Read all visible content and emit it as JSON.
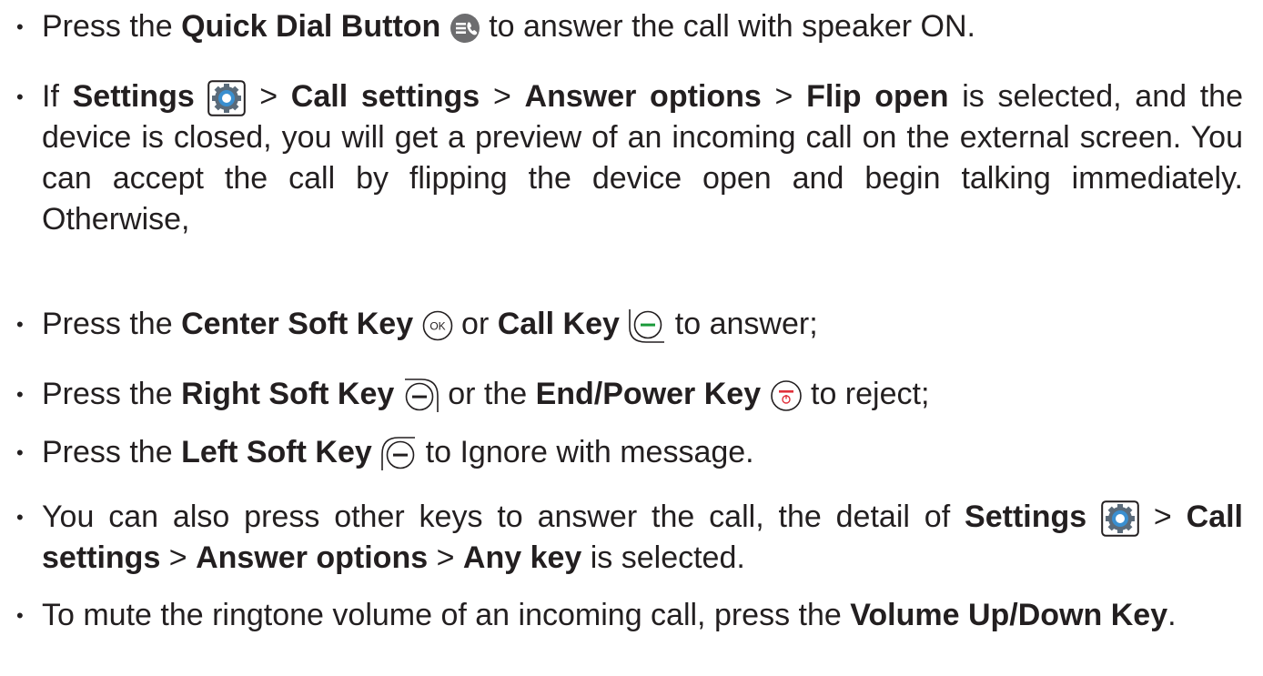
{
  "items": [
    {
      "t1": "Press the ",
      "b1": "Quick Dial Button",
      "t2": " to answer the call with speaker ON."
    },
    {
      "t1": "If ",
      "b1": "Settings",
      "t2": " > ",
      "b2": "Call settings",
      "t3": " > ",
      "b3": "Answer options",
      "t4": " > ",
      "b4": "Flip open",
      "t5": " is selected, and the device is closed, you will get a preview of an incoming call on the external screen. You can accept the call by flipping the device open and begin talking immediately. Otherwise,"
    },
    {
      "t1": "Press the ",
      "b1": "Center Soft Key",
      "t2": " or ",
      "b2": "Call Key",
      "t3": " to answer;"
    },
    {
      "t1": "Press the ",
      "b1": "Right Soft Key",
      "t2": " or the ",
      "b2": "End/Power Key",
      "t3": " to reject;"
    },
    {
      "t1": "Press the ",
      "b1": "Left Soft Key",
      "t2": " to Ignore with message."
    },
    {
      "t1": "You can also press other keys to answer the call, the detail of ",
      "b1": "Settings",
      "t2": " > ",
      "b2": "Call settings",
      "t3": " > ",
      "b3": "Answer options",
      "t4": " > ",
      "b4": "Any key",
      "t5": " is selected."
    },
    {
      "t1": "To mute the ringtone volume of an incoming call, press the ",
      "b1": "Volume Up/Down Key",
      "t2": "."
    }
  ],
  "bullet": "•",
  "icons": {
    "ok_label": "OK",
    "colors": {
      "green": "#1a9a3a",
      "red": "#e0303a",
      "gear_blue": "#3a8fd0",
      "dark": "#231f20"
    }
  }
}
